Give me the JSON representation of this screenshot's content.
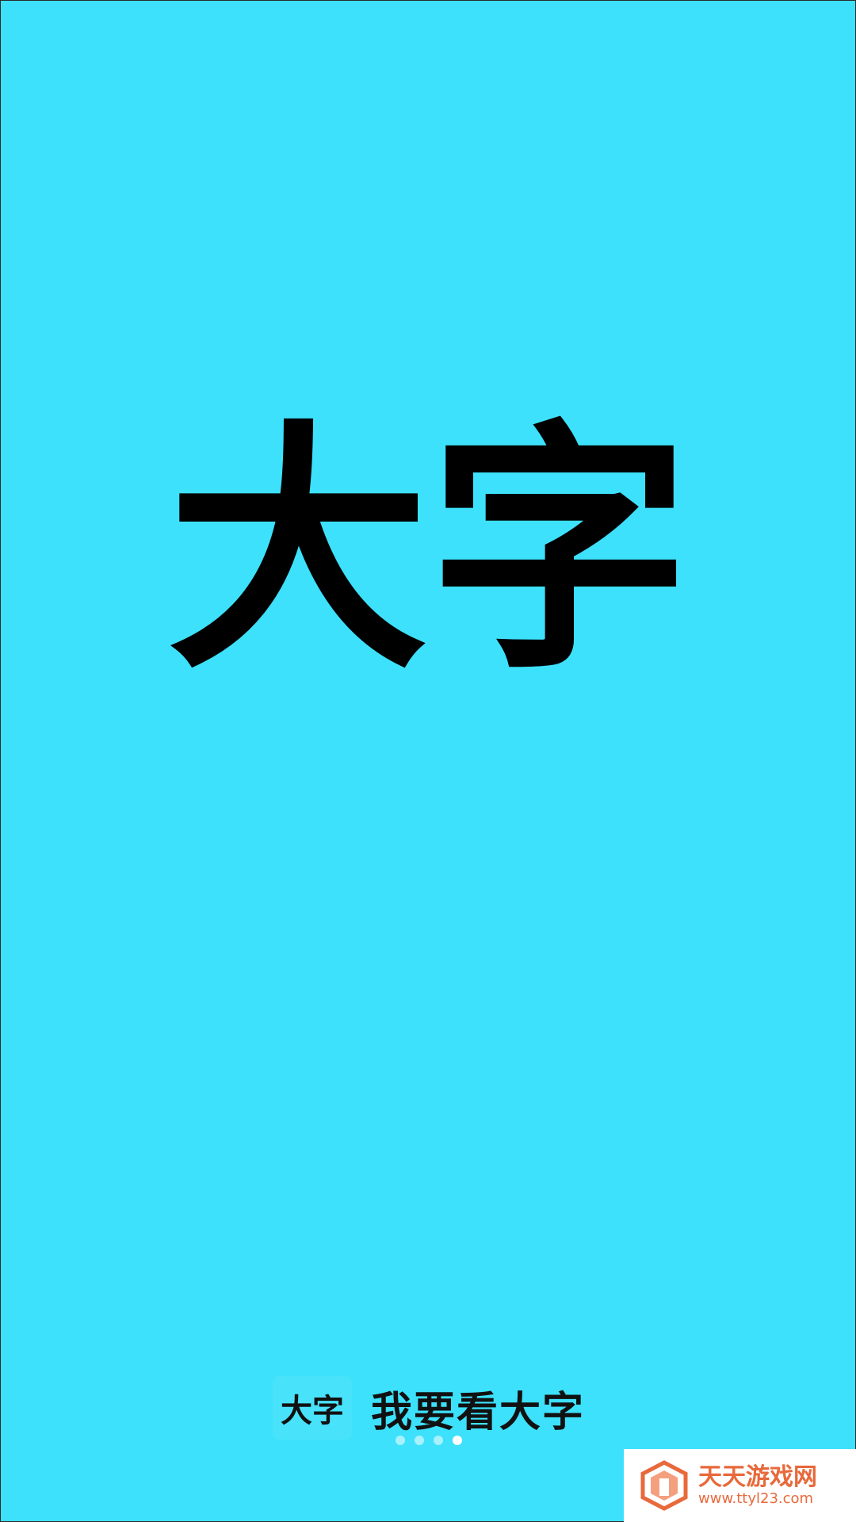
{
  "hero": {
    "text": "大字"
  },
  "brand": {
    "icon_text": "大字",
    "slogan": "我要看大字"
  },
  "pager": {
    "count": 4,
    "active_index": 3
  },
  "watermark": {
    "title": "天天游戏网",
    "url": "www.ttyl23.com"
  },
  "colors": {
    "background": "#3de1fb",
    "text": "#000000",
    "watermark_accent": "#e8693b"
  }
}
